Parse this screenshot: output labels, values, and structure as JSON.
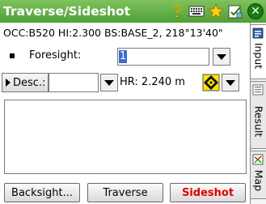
{
  "window": {
    "title": "Traverse/Sideshot"
  },
  "status": {
    "occ_line": "OCC:B520  HI:2.300  BS:BASE_2, 218°13'40\""
  },
  "foresight": {
    "label": "Foresight:",
    "value": "1"
  },
  "desc": {
    "button_label": "Desc.:",
    "value": ""
  },
  "hr": {
    "text": "HR: 2.240 m"
  },
  "buttons": {
    "backsight": "Backsight...",
    "traverse": "Traverse",
    "sideshot": "Sideshot"
  },
  "tabs": [
    {
      "label": "Input",
      "icon": "input-icon"
    },
    {
      "label": "Result",
      "icon": "result-icon"
    },
    {
      "label": "Map",
      "icon": "map-icon"
    }
  ],
  "colors": {
    "titlebar": "#5aa83e",
    "sideshot_text": "#e00000",
    "selection": "#3a6cc8"
  }
}
